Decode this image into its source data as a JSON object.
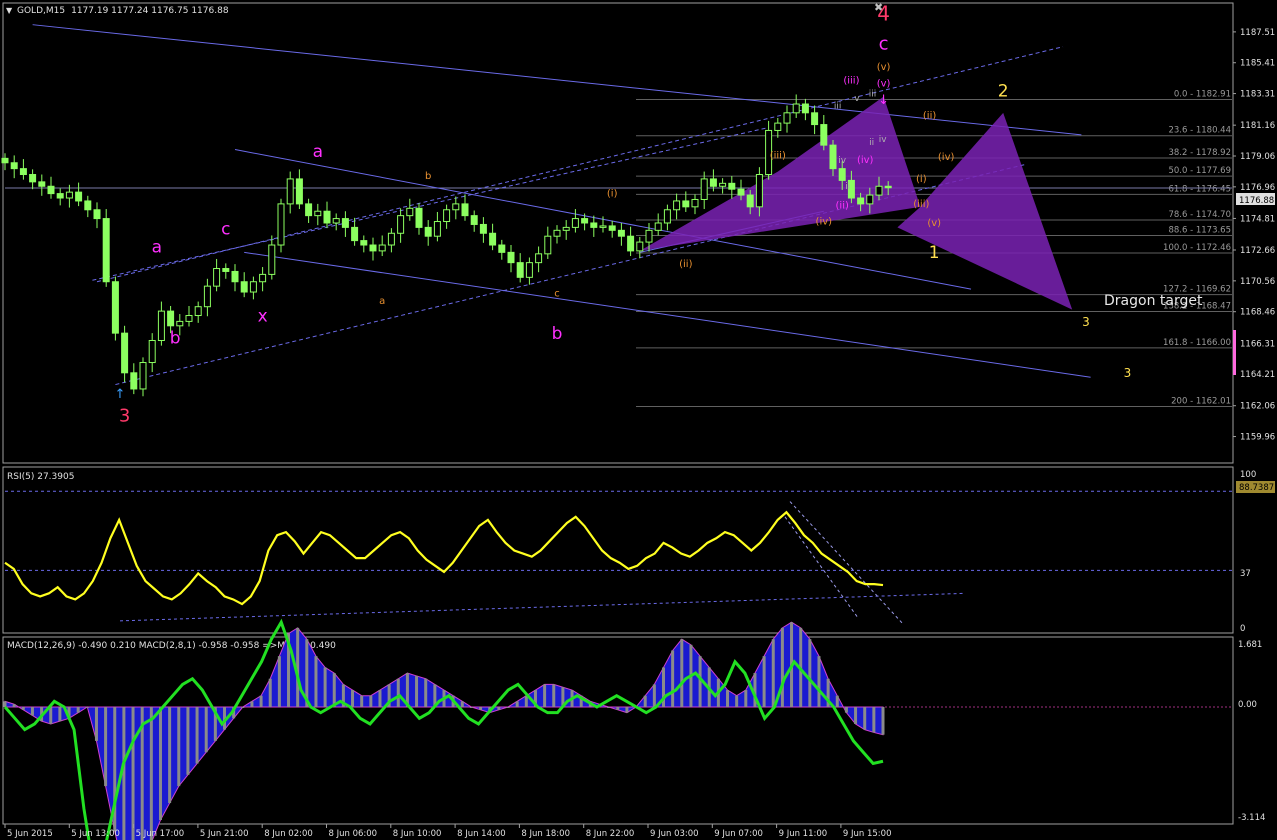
{
  "header": {
    "symbol": "GOLD,M15",
    "ohlc": "1177.19 1177.24 1176.75 1176.88"
  },
  "colors": {
    "background": "#000000",
    "frame": "#a0a0a0",
    "candle": "#8cff60",
    "channel": "#6a6ae8",
    "fib": "#606060",
    "pattern": "#7a22b4",
    "rsi": "#ffff20",
    "macd_hist": "#8a8a8a",
    "macd_fill": "#1a1ad0",
    "macd_line": "#22e022",
    "magenta": "#ff30ff",
    "red": "#ff3a6a",
    "orange": "#e89030",
    "yellow": "#ffe050"
  },
  "chart_data": [
    {
      "type": "candlestick",
      "name": "price",
      "symbol": "GOLD,M15",
      "ohlc_last": {
        "open": 1177.19,
        "high": 1177.24,
        "low": 1176.75,
        "close": 1176.88
      },
      "ylim": [
        1158.5,
        1189.0
      ],
      "y_ticks": [
        "1187.51",
        "1185.41",
        "1183.31",
        "1181.16",
        "1179.06",
        "1176.96",
        "1174.81",
        "1172.66",
        "1170.56",
        "1168.46",
        "1166.31",
        "1164.21",
        "1162.06",
        "1159.96"
      ],
      "current_price": "1176.88",
      "closes": [
        1178.6,
        1178.2,
        1177.8,
        1177.3,
        1177.0,
        1176.5,
        1176.2,
        1176.6,
        1176.0,
        1175.4,
        1174.8,
        1170.5,
        1167.0,
        1164.3,
        1163.2,
        1165.0,
        1166.5,
        1168.5,
        1167.5,
        1167.8,
        1168.2,
        1168.8,
        1170.2,
        1171.4,
        1171.2,
        1170.5,
        1169.8,
        1170.5,
        1171.0,
        1173.0,
        1175.8,
        1177.5,
        1175.8,
        1175.0,
        1175.3,
        1174.5,
        1174.8,
        1174.2,
        1173.3,
        1173.0,
        1172.6,
        1173.0,
        1173.8,
        1175.0,
        1175.5,
        1174.2,
        1173.6,
        1174.6,
        1175.4,
        1175.8,
        1175.0,
        1174.4,
        1173.8,
        1173.0,
        1172.5,
        1171.8,
        1170.8,
        1171.8,
        1172.4,
        1173.6,
        1174.0,
        1174.2,
        1174.8,
        1174.5,
        1174.2,
        1174.3,
        1174.0,
        1173.6,
        1172.6,
        1173.2,
        1174.0,
        1174.5,
        1175.4,
        1176.0,
        1175.6,
        1176.1,
        1177.5,
        1177.0,
        1177.2,
        1176.8,
        1176.4,
        1175.6,
        1177.8,
        1180.8,
        1181.3,
        1182.0,
        1182.6,
        1182.0,
        1181.2,
        1179.8,
        1178.2,
        1177.4,
        1176.2,
        1175.8,
        1176.4,
        1177.0,
        1176.9
      ],
      "x_labels": [
        "5 Jun 2015",
        "5 Jun 13:00",
        "5 Jun 17:00",
        "5 Jun 21:00",
        "8 Jun 02:00",
        "8 Jun 06:00",
        "8 Jun 10:00",
        "8 Jun 14:00",
        "8 Jun 18:00",
        "8 Jun 22:00",
        "9 Jun 03:00",
        "9 Jun 07:00",
        "9 Jun 11:00",
        "9 Jun 15:00"
      ],
      "fib_levels": [
        {
          "label": "0.0 - 1182.91",
          "value": 1182.91
        },
        {
          "label": "23.6 - 1180.44",
          "value": 1180.44
        },
        {
          "label": "38.2 - 1178.92",
          "value": 1178.92
        },
        {
          "label": "50.0 - 1177.69",
          "value": 1177.69
        },
        {
          "label": "61.8 - 1176.45",
          "value": 1176.45
        },
        {
          "label": "78.6 - 1174.70",
          "value": 1174.7
        },
        {
          "label": "88.6 - 1173.65",
          "value": 1173.65
        },
        {
          "label": "100.0 - 1172.46",
          "value": 1172.46
        },
        {
          "label": "127.2 - 1169.62",
          "value": 1169.62
        },
        {
          "label": "138.2 - 1168.47",
          "value": 1168.47
        },
        {
          "label": "161.8 - 1166.00",
          "value": 1166.0
        },
        {
          "label": "200 - 1162.01",
          "value": 1162.01
        }
      ],
      "pattern_label": "Dragon target",
      "wave_labels": [
        {
          "text": "4",
          "bar": 95.5,
          "y": 1188.3,
          "color": "red",
          "size": 20
        },
        {
          "text": "c",
          "bar": 95.5,
          "y": 1186.3,
          "color": "magenta",
          "size": 18
        },
        {
          "text": "(v)",
          "bar": 95.5,
          "y": 1184.9,
          "color": "orange",
          "size": 10
        },
        {
          "text": "(v)",
          "bar": 95.5,
          "y": 1183.8,
          "color": "magenta",
          "size": 10
        },
        {
          "text": "(iii)",
          "bar": 92.0,
          "y": 1184.0,
          "color": "magenta",
          "size": 10
        },
        {
          "text": "iii",
          "bar": 94.3,
          "y": 1183.1,
          "color": "grey",
          "size": 9
        },
        {
          "text": "v",
          "bar": 92.6,
          "y": 1182.8,
          "color": "grey",
          "size": 9
        },
        {
          "text": "iii",
          "bar": 90.5,
          "y": 1182.3,
          "color": "grey",
          "size": 9
        },
        {
          "text": "iv",
          "bar": 95.4,
          "y": 1180.0,
          "color": "grey",
          "size": 9
        },
        {
          "text": "ii",
          "bar": 94.2,
          "y": 1179.8,
          "color": "grey",
          "size": 9
        },
        {
          "text": "iv",
          "bar": 91.0,
          "y": 1178.6,
          "color": "grey",
          "size": 9
        },
        {
          "text": "(iv)",
          "bar": 93.5,
          "y": 1178.6,
          "color": "magenta",
          "size": 10
        },
        {
          "text": "ii",
          "bar": 91.6,
          "y": 1176.8,
          "color": "grey",
          "size": 9
        },
        {
          "text": "(ii)",
          "bar": 91.0,
          "y": 1175.5,
          "color": "magenta",
          "size": 10
        },
        {
          "text": "(ii)",
          "bar": 100.5,
          "y": 1181.6,
          "color": "orange",
          "size": 10
        },
        {
          "text": "(iv)",
          "bar": 102.3,
          "y": 1178.8,
          "color": "orange",
          "size": 10
        },
        {
          "text": "(i)",
          "bar": 99.6,
          "y": 1177.3,
          "color": "orange",
          "size": 10
        },
        {
          "text": "(iii)",
          "bar": 99.6,
          "y": 1175.6,
          "color": "orange",
          "size": 10
        },
        {
          "text": "(v)",
          "bar": 101.0,
          "y": 1174.3,
          "color": "orange",
          "size": 10
        },
        {
          "text": "1",
          "bar": 101.0,
          "y": 1172.1,
          "color": "yellow",
          "size": 17
        },
        {
          "text": "2",
          "bar": 108.5,
          "y": 1183.1,
          "color": "yellow",
          "size": 17
        },
        {
          "text": "3",
          "bar": 117.5,
          "y": 1167.5,
          "color": "yellow",
          "size": 12
        },
        {
          "text": "3",
          "bar": 122.0,
          "y": 1164.0,
          "color": "yellow",
          "size": 12
        },
        {
          "text": "(iii)",
          "bar": 84.0,
          "y": 1178.9,
          "color": "orange",
          "size": 10
        },
        {
          "text": "(iv)",
          "bar": 89.0,
          "y": 1174.4,
          "color": "orange",
          "size": 10
        },
        {
          "text": "(i)",
          "bar": 66.0,
          "y": 1176.3,
          "color": "orange",
          "size": 10
        },
        {
          "text": "(ii)",
          "bar": 74.0,
          "y": 1171.5,
          "color": "orange",
          "size": 10
        },
        {
          "text": "a",
          "bar": 16.5,
          "y": 1172.5,
          "color": "magenta",
          "size": 17
        },
        {
          "text": "b",
          "bar": 18.5,
          "y": 1166.3,
          "color": "magenta",
          "size": 17
        },
        {
          "text": "c",
          "bar": 24.0,
          "y": 1173.7,
          "color": "magenta",
          "size": 17
        },
        {
          "text": "x",
          "bar": 28.0,
          "y": 1167.8,
          "color": "magenta",
          "size": 17
        },
        {
          "text": "a",
          "bar": 34.0,
          "y": 1179.0,
          "color": "magenta",
          "size": 17
        },
        {
          "text": "b",
          "bar": 60.0,
          "y": 1166.6,
          "color": "magenta",
          "size": 17
        },
        {
          "text": "3",
          "bar": 13.0,
          "y": 1161.0,
          "color": "red",
          "size": 18
        },
        {
          "text": "b",
          "bar": 46.0,
          "y": 1177.5,
          "color": "orange",
          "size": 10
        },
        {
          "text": "a",
          "bar": 41.0,
          "y": 1169.0,
          "color": "orange",
          "size": 10
        },
        {
          "text": "c",
          "bar": 60.0,
          "y": 1169.5,
          "color": "orange",
          "size": 10
        }
      ]
    },
    {
      "type": "line",
      "name": "RSI(5)",
      "title": "RSI(5) 27.3905",
      "ylim": [
        0,
        100
      ],
      "y_ticks": [
        "100",
        "37",
        "0"
      ],
      "levels": [
        88.7387,
        37
      ],
      "level_label": "88.7387",
      "values": [
        42,
        38,
        28,
        22,
        20,
        22,
        26,
        20,
        18,
        22,
        30,
        42,
        58,
        70,
        55,
        40,
        30,
        25,
        20,
        18,
        22,
        28,
        35,
        30,
        26,
        20,
        18,
        15,
        20,
        30,
        50,
        60,
        62,
        56,
        48,
        55,
        62,
        60,
        55,
        50,
        45,
        45,
        50,
        55,
        60,
        62,
        58,
        50,
        44,
        40,
        36,
        42,
        50,
        58,
        66,
        70,
        62,
        55,
        50,
        48,
        46,
        50,
        56,
        62,
        68,
        72,
        66,
        58,
        50,
        45,
        42,
        38,
        40,
        45,
        48,
        55,
        52,
        48,
        46,
        50,
        55,
        58,
        62,
        60,
        55,
        50,
        55,
        62,
        70,
        75,
        68,
        60,
        55,
        48,
        44,
        40,
        36,
        30,
        28,
        28,
        27.39
      ]
    },
    {
      "type": "area",
      "name": "MACD",
      "title": "MACD(12,26,9) -0.490 0.210  MACD(2,8,1) -0.958 -0.958  =>MA(1) -0.490",
      "ylim": [
        -3.4,
        1.9
      ],
      "y_ticks": [
        "1.681",
        "0.00",
        "-3.114"
      ],
      "hist": [
        0.1,
        0.05,
        -0.05,
        -0.15,
        -0.25,
        -0.3,
        -0.25,
        -0.2,
        -0.1,
        0.0,
        -0.6,
        -1.4,
        -2.2,
        -2.9,
        -3.1,
        -2.8,
        -2.4,
        -2.0,
        -1.7,
        -1.4,
        -1.2,
        -1.0,
        -0.8,
        -0.6,
        -0.4,
        -0.2,
        0.0,
        0.1,
        0.2,
        0.5,
        0.9,
        1.3,
        1.4,
        1.2,
        0.9,
        0.7,
        0.6,
        0.4,
        0.3,
        0.2,
        0.2,
        0.3,
        0.4,
        0.5,
        0.6,
        0.55,
        0.5,
        0.4,
        0.3,
        0.2,
        0.1,
        0.0,
        -0.05,
        -0.1,
        -0.05,
        0.0,
        0.1,
        0.2,
        0.3,
        0.4,
        0.4,
        0.35,
        0.3,
        0.2,
        0.1,
        0.05,
        0.0,
        -0.05,
        -0.1,
        0.0,
        0.2,
        0.4,
        0.7,
        1.0,
        1.2,
        1.1,
        0.9,
        0.7,
        0.5,
        0.3,
        0.2,
        0.3,
        0.6,
        0.9,
        1.2,
        1.4,
        1.5,
        1.4,
        1.2,
        0.9,
        0.5,
        0.2,
        -0.1,
        -0.3,
        -0.4,
        -0.45,
        -0.49
      ],
      "fast": [
        0.0,
        -0.2,
        -0.4,
        -0.3,
        -0.1,
        0.1,
        0.0,
        -0.4,
        -1.8,
        -2.9,
        -2.6,
        -1.8,
        -1.0,
        -0.6,
        -0.3,
        -0.2,
        0.0,
        0.2,
        0.4,
        0.5,
        0.3,
        0.0,
        -0.3,
        -0.1,
        0.2,
        0.5,
        0.8,
        1.2,
        1.5,
        1.0,
        0.3,
        0.0,
        -0.1,
        0.0,
        0.1,
        0.0,
        -0.2,
        -0.3,
        -0.1,
        0.1,
        0.2,
        0.0,
        -0.2,
        -0.1,
        0.1,
        0.2,
        0.0,
        -0.2,
        -0.3,
        -0.1,
        0.1,
        0.3,
        0.4,
        0.2,
        0.0,
        -0.1,
        -0.1,
        0.1,
        0.2,
        0.1,
        0.0,
        0.1,
        0.2,
        0.1,
        0.0,
        -0.1,
        0.0,
        0.2,
        0.3,
        0.5,
        0.6,
        0.4,
        0.2,
        0.4,
        0.8,
        0.6,
        0.2,
        -0.2,
        0.0,
        0.5,
        0.8,
        0.6,
        0.4,
        0.2,
        0.0,
        -0.3,
        -0.6,
        -0.8,
        -1.0,
        -0.96
      ]
    }
  ]
}
